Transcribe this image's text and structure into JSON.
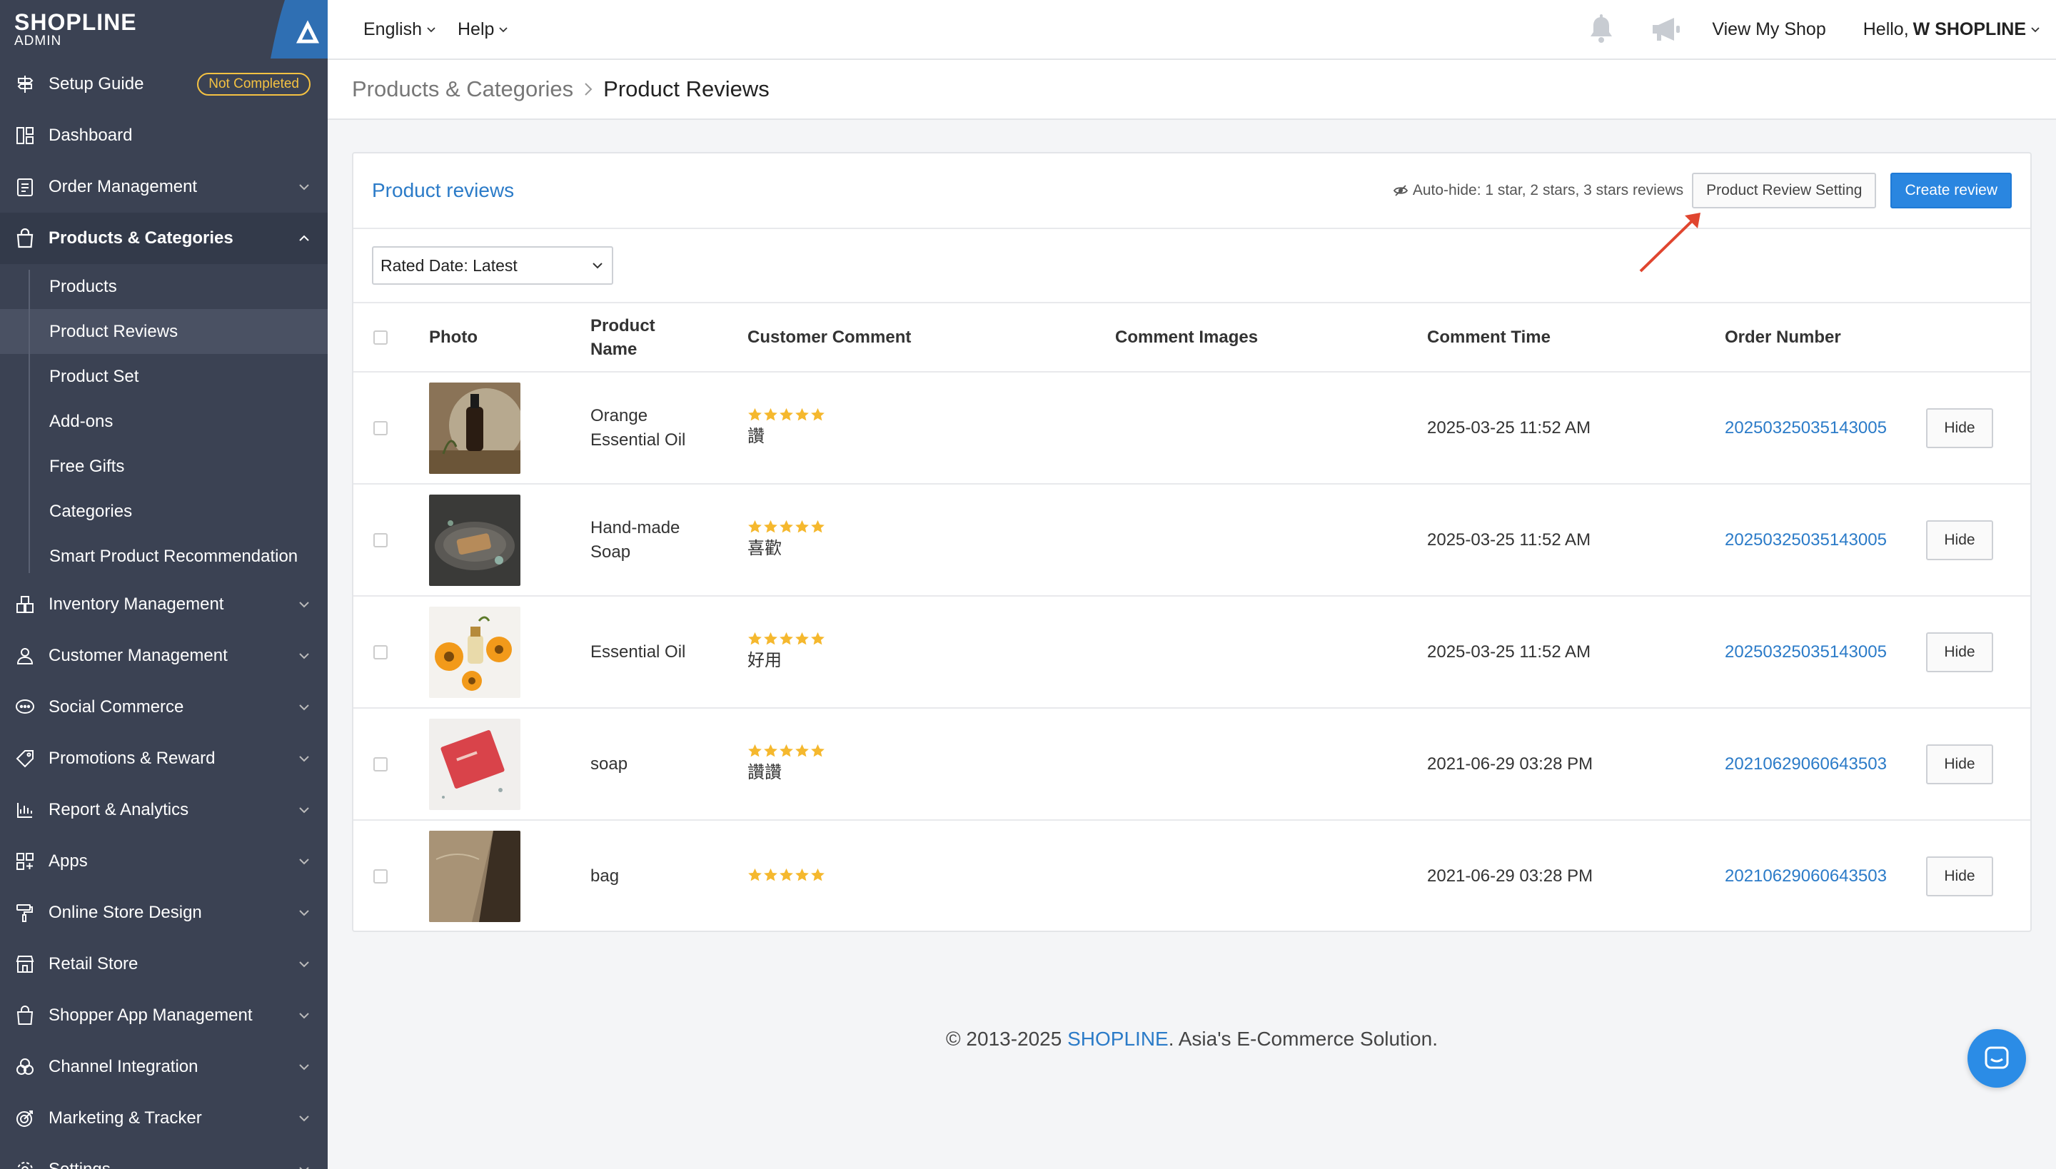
{
  "brand": {
    "name": "SHOPLINE",
    "sub": "ADMIN"
  },
  "sidebar": {
    "setup_guide": {
      "label": "Setup Guide",
      "badge": "Not Completed"
    },
    "items_top": [
      {
        "label": "Dashboard"
      },
      {
        "label": "Order Management"
      }
    ],
    "products": {
      "label": "Products & Categories",
      "children": [
        {
          "label": "Products"
        },
        {
          "label": "Product Reviews"
        },
        {
          "label": "Product Set"
        },
        {
          "label": "Add-ons"
        },
        {
          "label": "Free Gifts"
        },
        {
          "label": "Categories"
        },
        {
          "label": "Smart Product Recommendation"
        }
      ]
    },
    "items_bottom": [
      {
        "label": "Inventory Management"
      },
      {
        "label": "Customer Management"
      },
      {
        "label": "Social Commerce"
      },
      {
        "label": "Promotions & Reward"
      },
      {
        "label": "Report & Analytics"
      },
      {
        "label": "Apps"
      },
      {
        "label": "Online Store Design"
      },
      {
        "label": "Retail Store"
      },
      {
        "label": "Shopper App Management"
      },
      {
        "label": "Channel Integration"
      },
      {
        "label": "Marketing & Tracker"
      },
      {
        "label": "Settings"
      }
    ]
  },
  "topbar": {
    "language": "English",
    "help": "Help",
    "view_shop": "View My Shop",
    "hello": "Hello,",
    "user": "W SHOPLINE"
  },
  "breadcrumb": {
    "parent": "Products & Categories",
    "current": "Product Reviews"
  },
  "card": {
    "title": "Product reviews",
    "autohide": "Auto-hide: 1 star, 2 stars, 3 stars reviews",
    "setting_button": "Product Review Setting",
    "create_button": "Create review",
    "sort_select": "Rated Date: Latest"
  },
  "table": {
    "headers": {
      "photo": "Photo",
      "product_name": "Product Name",
      "comment": "Customer Comment",
      "images": "Comment Images",
      "time": "Comment Time",
      "order": "Order Number"
    },
    "hide_label": "Hide",
    "rows": [
      {
        "name": "Orange Essential Oil",
        "rating": 5,
        "comment": "讚",
        "time": "2025-03-25 11:52 AM",
        "order": "20250325035143005",
        "photo": "oil-bottle"
      },
      {
        "name": "Hand-made Soap",
        "rating": 5,
        "comment": "喜歡",
        "time": "2025-03-25 11:52 AM",
        "order": "20250325035143005",
        "photo": "soap-dish"
      },
      {
        "name": "Essential Oil",
        "rating": 5,
        "comment": "好用",
        "time": "2025-03-25 11:52 AM",
        "order": "20250325035143005",
        "photo": "flowers-oil"
      },
      {
        "name": "soap",
        "rating": 5,
        "comment": "讚讚",
        "time": "2021-06-29 03:28 PM",
        "order": "20210629060643503",
        "photo": "red-soap"
      },
      {
        "name": "bag",
        "rating": 5,
        "comment": "",
        "time": "2021-06-29 03:28 PM",
        "order": "20210629060643503",
        "photo": "bag"
      }
    ]
  },
  "footer": {
    "prefix": "© 2013-2025 ",
    "brand": "SHOPLINE",
    "suffix": ". Asia's E-Commerce Solution."
  },
  "colors": {
    "sidebar": "#3b4253",
    "accent": "#2b7bc8",
    "primary": "#2a86e0",
    "badge": "#f5c242",
    "star": "#f5b82e",
    "arrow": "#e0452f"
  }
}
